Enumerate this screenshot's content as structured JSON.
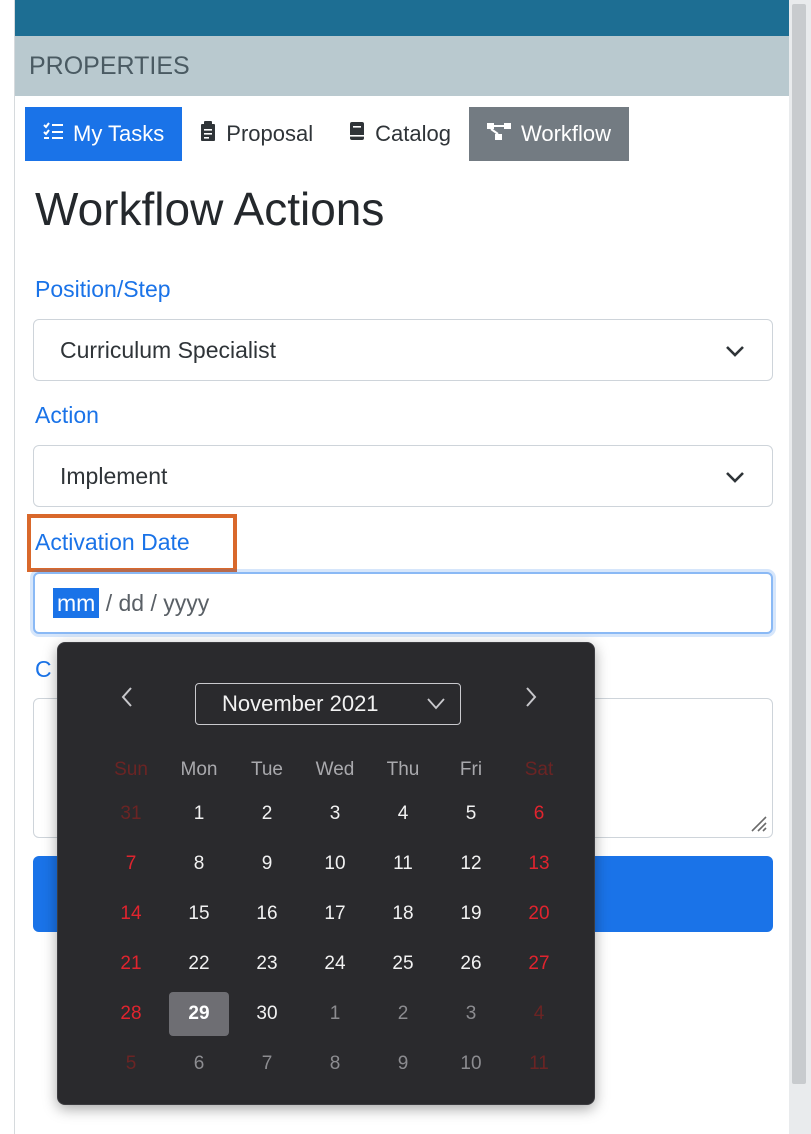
{
  "header": {
    "title": "PROPERTIES"
  },
  "tabs": [
    {
      "label": "My Tasks",
      "icon": "list-check-icon"
    },
    {
      "label": "Proposal",
      "icon": "clipboard-icon"
    },
    {
      "label": "Catalog",
      "icon": "book-icon"
    },
    {
      "label": "Workflow",
      "icon": "workflow-icon"
    }
  ],
  "page": {
    "title": "Workflow Actions"
  },
  "form": {
    "position_label": "Position/Step",
    "position_value": "Curriculum Specialist",
    "action_label": "Action",
    "action_value": "Implement",
    "activation_label": "Activation Date",
    "date_mm": "mm",
    "date_rest": " / dd / yyyy",
    "comments_label": "C"
  },
  "calendar": {
    "month_label": "November 2021",
    "weekdays": [
      "Sun",
      "Mon",
      "Tue",
      "Wed",
      "Thu",
      "Fri",
      "Sat"
    ],
    "weeks": [
      [
        "31",
        "1",
        "2",
        "3",
        "4",
        "5",
        "6"
      ],
      [
        "7",
        "8",
        "9",
        "10",
        "11",
        "12",
        "13"
      ],
      [
        "14",
        "15",
        "16",
        "17",
        "18",
        "19",
        "20"
      ],
      [
        "21",
        "22",
        "23",
        "24",
        "25",
        "26",
        "27"
      ],
      [
        "28",
        "29",
        "30",
        "1",
        "2",
        "3",
        "4"
      ],
      [
        "5",
        "6",
        "7",
        "8",
        "9",
        "10",
        "11"
      ]
    ],
    "selected_day": "29",
    "colors": {
      "background": "#2a2a2d",
      "weekend": "#e0242e",
      "selected": "#6e6e73"
    }
  },
  "colors": {
    "accent": "#1a73e8",
    "topbar": "#1d6e93",
    "header_bg": "#b9c9cf",
    "highlight": "#d9682b"
  }
}
